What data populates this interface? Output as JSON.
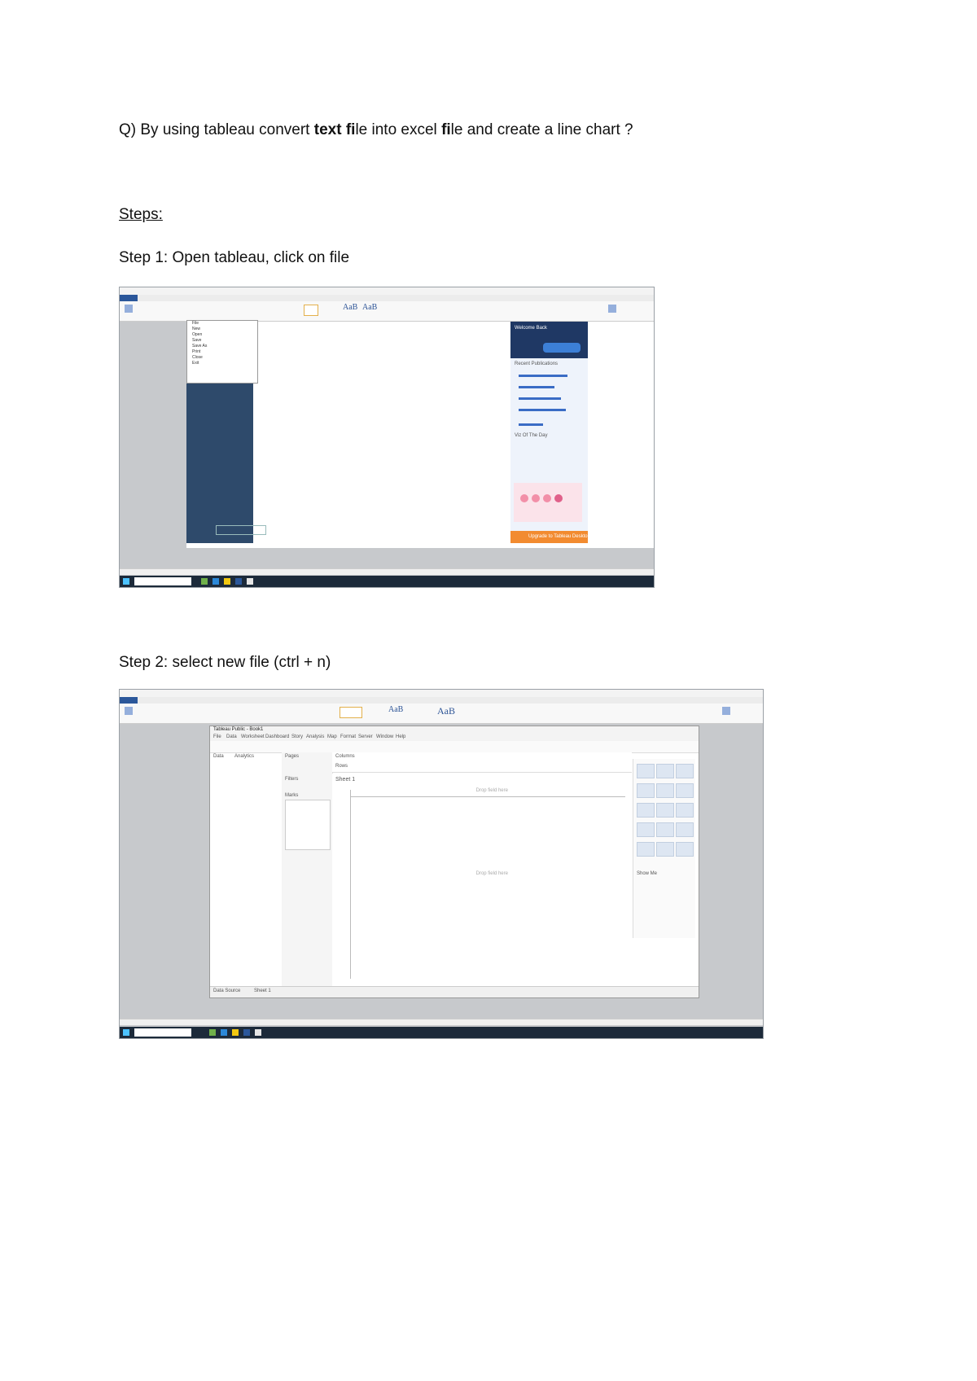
{
  "question": {
    "prefix": "Q) By using tableau convert ",
    "bold1": "text",
    "middle1": " ",
    "bold2": "fi",
    "middle2": "le into excel ",
    "bold3": "fi",
    "middle3": "le and create a line chart ?"
  },
  "steps_heading": "Steps:",
  "step1": {
    "label": "Step 1:",
    "text": " Open tableau, click on file"
  },
  "step2": {
    "label": "Step 2:",
    "text": " select new file (ctrl + n)"
  },
  "screenshot1": {
    "menu_items": [
      "File",
      "New",
      "Open",
      "Save",
      "Save As",
      "Print",
      "Close",
      "Exit"
    ],
    "welcome_title": "Welcome Back",
    "panel_heading": "Recent Publications",
    "viz_heading": "Viz Of The Day",
    "cta": "Upgrade to Tableau Desktop"
  },
  "screenshot2": {
    "window_title": "Tableau Public - Book1",
    "menus": [
      "File",
      "Data",
      "Worksheet",
      "Dashboard",
      "Story",
      "Analysis",
      "Map",
      "Format",
      "Server",
      "Window",
      "Help"
    ],
    "data_tab": "Data",
    "analytics_tab": "Analytics",
    "pages": "Pages",
    "filters": "Filters",
    "marks": "Marks",
    "columns": "Columns",
    "rows": "Rows",
    "sheet_title": "Sheet 1",
    "drop_field": "Drop field here",
    "show_me": "Show Me",
    "bottom_tabs": [
      "Data Source",
      "Sheet 1"
    ]
  },
  "colors": {
    "ribbon_blue": "#2b579a",
    "tableau_navy": "#2e4a6b",
    "orange": "#f28b30",
    "taskbar": "#1c2a3a"
  }
}
